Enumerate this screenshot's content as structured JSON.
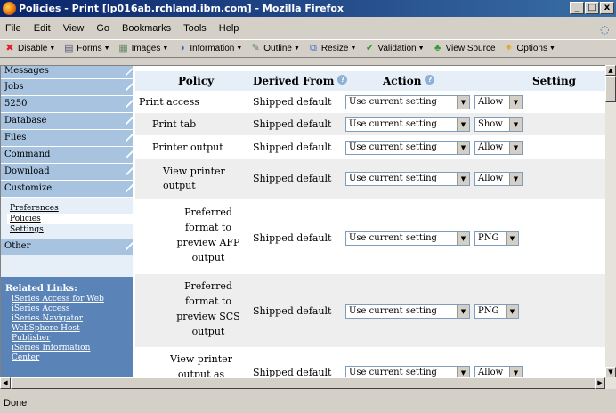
{
  "window": {
    "title": "Policies - Print [lp016ab.rchland.ibm.com] - Mozilla Firefox"
  },
  "menu": [
    "File",
    "Edit",
    "View",
    "Go",
    "Bookmarks",
    "Tools",
    "Help"
  ],
  "toolbar": {
    "disable": "Disable",
    "forms": "Forms",
    "images": "Images",
    "information": "Information",
    "outline": "Outline",
    "resize": "Resize",
    "validation": "Validation",
    "view_source": "View Source",
    "options": "Options"
  },
  "sidebar": {
    "items": [
      "Messages",
      "Jobs",
      "5250",
      "Database",
      "Files",
      "Command",
      "Download",
      "Customize"
    ],
    "sub_items": [
      "Preferences",
      "Policies",
      "Settings"
    ],
    "other": "Other",
    "related_heading": "Related Links:",
    "related_links": [
      "iSeries Access for Web",
      "iSeries Access",
      "iSeries Navigator",
      "WebSphere Host",
      "Publisher",
      "iSeries Information",
      "Center"
    ]
  },
  "table": {
    "headers": {
      "policy": "Policy",
      "derived": "Derived From",
      "action": "Action",
      "setting": "Setting"
    },
    "rows": [
      {
        "policy": "Print access",
        "derived": "Shipped default",
        "action": "Use current setting",
        "setting": "Allow"
      },
      {
        "policy": "Print tab",
        "derived": "Shipped default",
        "action": "Use current setting",
        "setting": "Show"
      },
      {
        "policy": "Printer output",
        "derived": "Shipped default",
        "action": "Use current setting",
        "setting": "Allow"
      },
      {
        "policy": "View printer output",
        "derived": "Shipped default",
        "action": "Use current setting",
        "setting": "Allow"
      },
      {
        "policy": "Preferred format to preview AFP output",
        "derived": "Shipped default",
        "action": "Use current setting",
        "setting": "PNG"
      },
      {
        "policy": "Preferred format to preview SCS output",
        "derived": "Shipped default",
        "action": "Use current setting",
        "setting": "PNG"
      },
      {
        "policy": "View printer output as",
        "derived": "Shipped default",
        "action": "Use current setting",
        "setting": "Allow"
      }
    ]
  },
  "status": {
    "text": "Done"
  }
}
